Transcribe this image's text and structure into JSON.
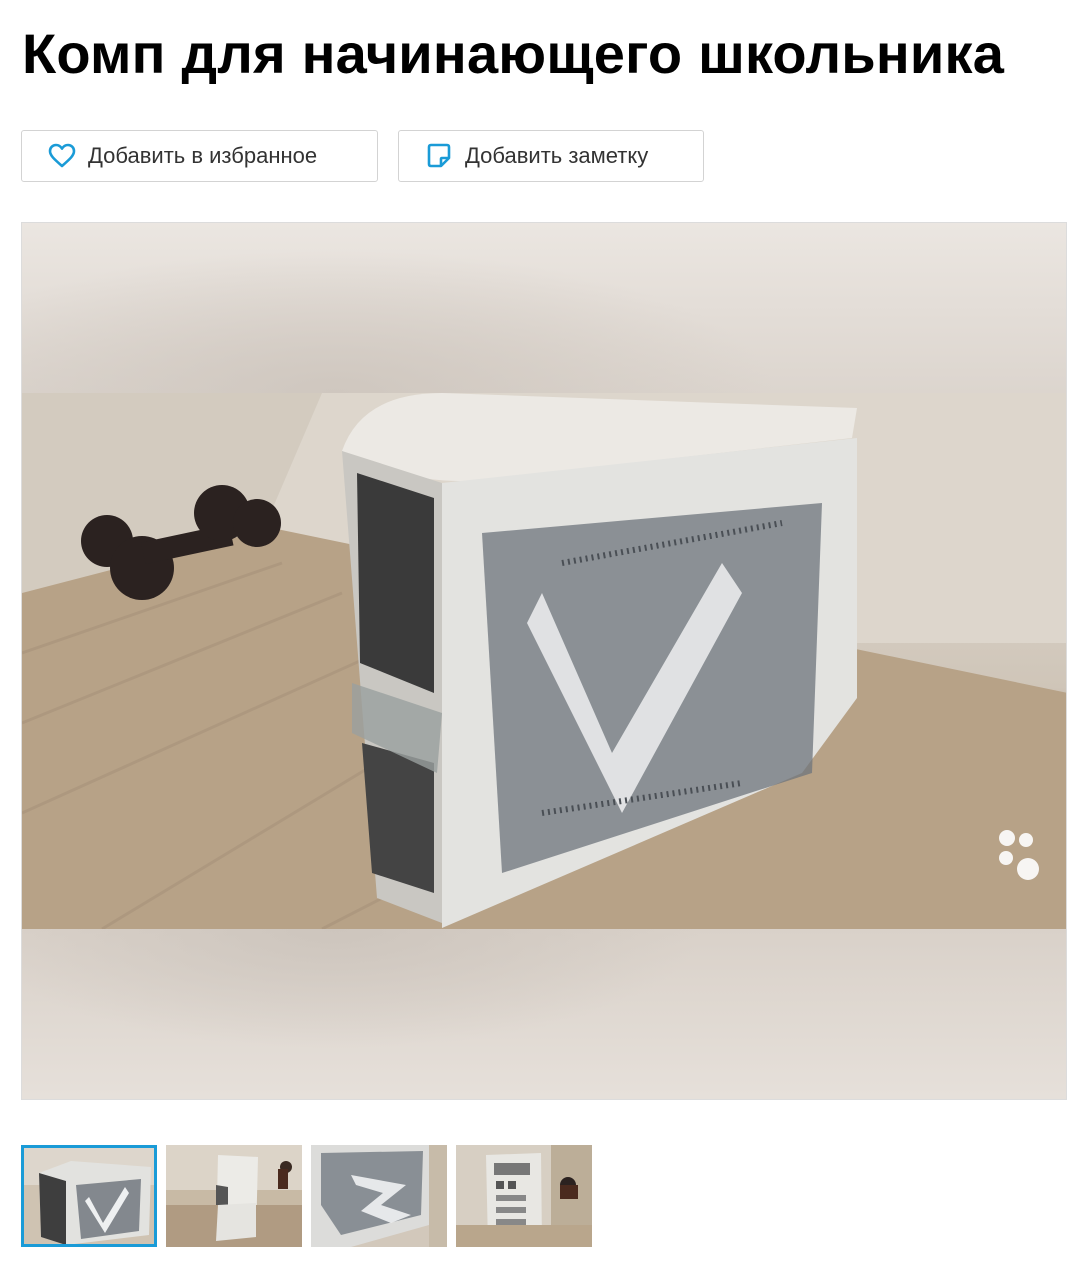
{
  "listing": {
    "title": "Комп для начинающего школьника"
  },
  "actions": {
    "favorite_label": "Добавить в избранное",
    "note_label": "Добавить заметку"
  },
  "icons": {
    "favorite": "heart-outline-icon",
    "note": "note-icon"
  },
  "colors": {
    "accent": "#1a9bd7",
    "icon_blue": "#1a9bd7"
  },
  "gallery": {
    "thumbnail_count": 4,
    "active_index": 0
  }
}
